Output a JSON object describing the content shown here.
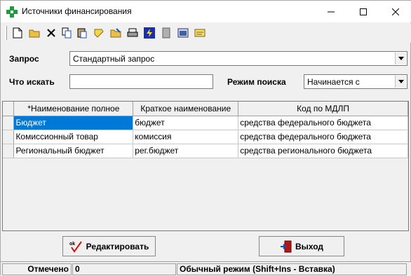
{
  "window": {
    "title": "Источники финансирования"
  },
  "query": {
    "label": "Запрос",
    "value": "Стандартный запрос"
  },
  "search": {
    "label": "Что искать",
    "value": "",
    "mode_label": "Режим поиска",
    "mode_value": "Начинается с"
  },
  "grid": {
    "columns": [
      "*Наименование полное",
      "Краткое наименование",
      "Код по МДЛП"
    ],
    "rows": [
      [
        "Бюджет",
        "бюджет",
        "средства федерального бюджета"
      ],
      [
        "Комиссионный товар",
        "комиссия",
        "средства федерального бюджета"
      ],
      [
        "Региональный бюджет",
        "рег.бюджет",
        "средства регионального бюджета"
      ]
    ]
  },
  "buttons": {
    "edit": "Редактировать",
    "exit": "Выход"
  },
  "status": {
    "marked_label": "Отмечено",
    "marked_count": "0",
    "mode": "Обычный режим (Shift+Ins - Вставка)"
  },
  "colors": {
    "selection": "#0078d7"
  }
}
